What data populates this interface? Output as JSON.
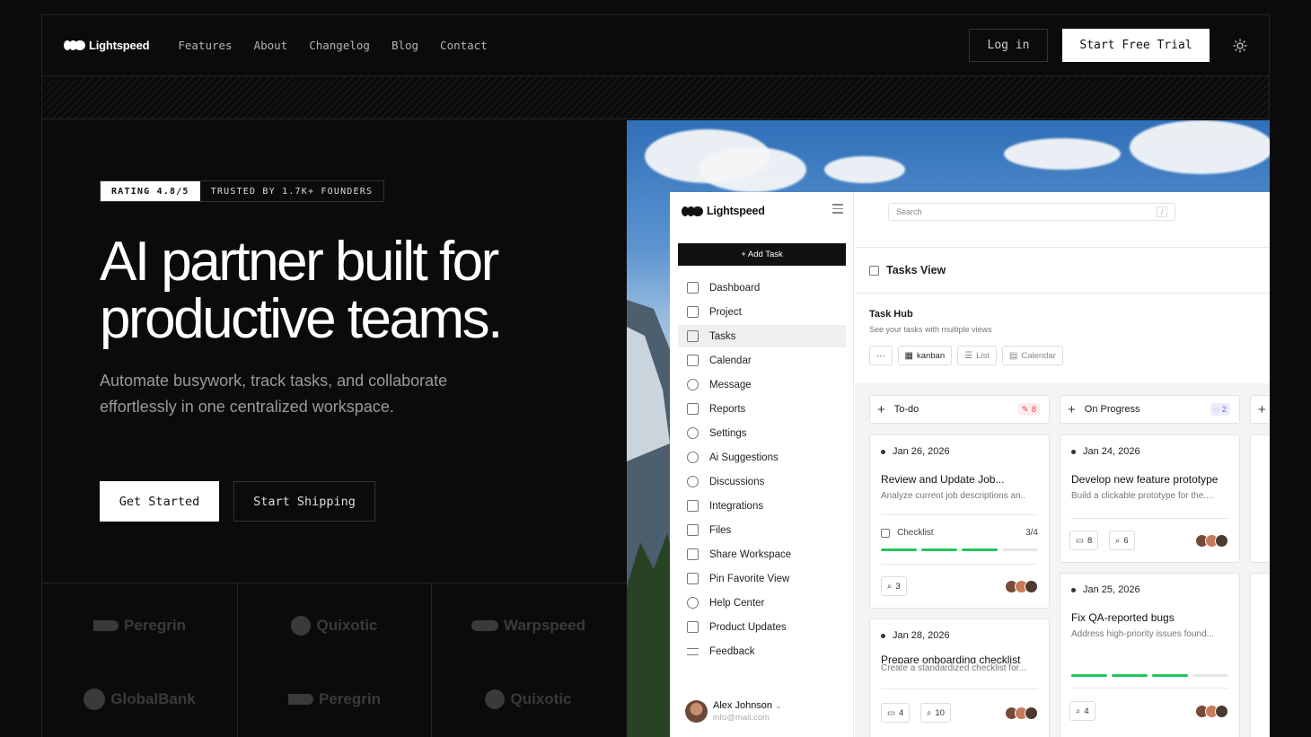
{
  "nav": {
    "brand": "Lightspeed",
    "links": [
      "Features",
      "About",
      "Changelog",
      "Blog",
      "Contact"
    ],
    "login": "Log in",
    "trial": "Start Free Trial"
  },
  "hero": {
    "rating": "RATING 4.8/5",
    "trusted": "TRUSTED BY 1.7K+ FOUNDERS",
    "headline_1": "AI partner built for",
    "headline_2": "productive teams.",
    "sub": "Automate busywork, track tasks, and collaborate effortlessly in one centralized workspace.",
    "cta_primary": "Get Started",
    "cta_secondary": "Start Shipping"
  },
  "logos": [
    "Peregrin",
    "Quixotic",
    "Warpspeed",
    "GlobalBank",
    "Peregrin",
    "Quixotic"
  ],
  "app": {
    "brand": "Lightspeed",
    "add_task": "+ Add Task",
    "sidebar": [
      "Dashboard",
      "Project",
      "Tasks",
      "Calendar",
      "Message",
      "Reports",
      "Settings",
      "Ai Suggestions",
      "Discussions",
      "Integrations",
      "Files",
      "Share Workspace",
      "Pin Favorite View",
      "Help Center",
      "Product Updates",
      "Feedback"
    ],
    "active_item": "Tasks",
    "user": {
      "name": "Alex Johnson",
      "email": "info@mail.com"
    },
    "search_placeholder": "Search",
    "search_key": "/",
    "tasks_view": "Tasks View",
    "hub_title": "Task Hub",
    "hub_sub": "See your tasks with multiple views",
    "views": {
      "more": "···",
      "kanban": "kanban",
      "list": "List",
      "calendar": "Calendar"
    },
    "columns": [
      {
        "name": "To-do",
        "count": "8",
        "color": "#ef4444",
        "bg": "#fdecec"
      },
      {
        "name": "On Progress",
        "count": "2",
        "color": "#6366f1",
        "bg": "#ececfd"
      }
    ],
    "cards": {
      "todo_1": {
        "date": "Jan 26, 2026",
        "title": "Review and Update Job...",
        "desc": "Analyze current job descriptions an..",
        "checklist": "Checklist",
        "progress": "3/4",
        "attachments": "3"
      },
      "todo_2": {
        "date": "Jan 28, 2026",
        "title": "Prepare onboarding checklist",
        "desc": "Create a standardized checklist for...",
        "comments": "4",
        "attachments": "10"
      },
      "prog_1": {
        "date": "Jan 24, 2026",
        "title": "Develop new feature prototype",
        "desc": "Build a clickable prototype for the....",
        "comments": "8",
        "attachments": "6"
      },
      "prog_2": {
        "date": "Jan 25, 2026",
        "title": "Fix QA-reported bugs",
        "desc": "Address high-priority issues found...",
        "attachments": "4"
      }
    }
  }
}
